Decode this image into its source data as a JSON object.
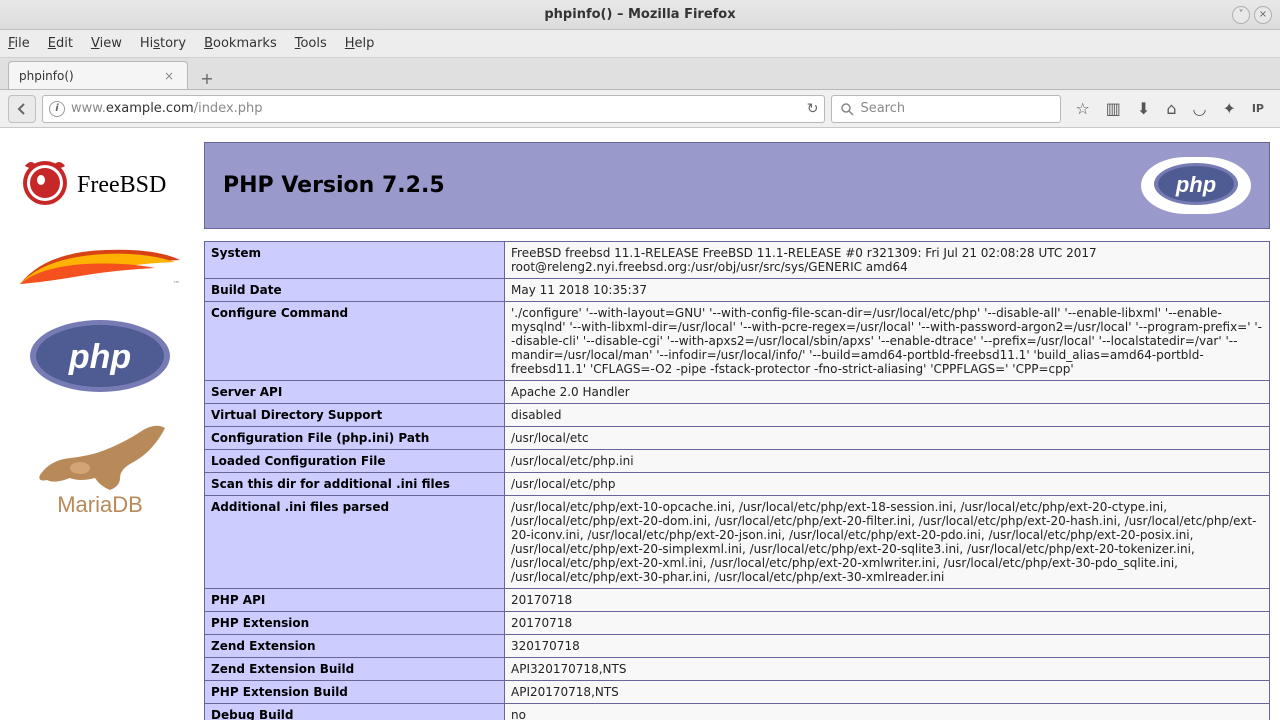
{
  "window": {
    "title": "phpinfo() – Mozilla Firefox"
  },
  "menu": {
    "file": "File",
    "edit": "Edit",
    "view": "View",
    "history": "History",
    "bookmarks": "Bookmarks",
    "tools": "Tools",
    "help": "Help"
  },
  "tab": {
    "title": "phpinfo()"
  },
  "url": {
    "prefix": "www.",
    "host": "example.com",
    "path": "/index.php"
  },
  "search": {
    "placeholder": "Search"
  },
  "sidebar": {
    "logos": [
      {
        "name": "FreeBSD"
      },
      {
        "name": "Apache"
      },
      {
        "name": "php"
      },
      {
        "name": "MariaDB"
      }
    ]
  },
  "php": {
    "header": "PHP Version 7.2.5",
    "rows": [
      {
        "k": "System",
        "v": "FreeBSD freebsd 11.1-RELEASE FreeBSD 11.1-RELEASE #0 r321309: Fri Jul 21 02:08:28 UTC 2017 root@releng2.nyi.freebsd.org:/usr/obj/usr/src/sys/GENERIC amd64"
      },
      {
        "k": "Build Date",
        "v": "May 11 2018 10:35:37"
      },
      {
        "k": "Configure Command",
        "v": "'./configure' '--with-layout=GNU' '--with-config-file-scan-dir=/usr/local/etc/php' '--disable-all' '--enable-libxml' '--enable-mysqlnd' '--with-libxml-dir=/usr/local' '--with-pcre-regex=/usr/local' '--with-password-argon2=/usr/local' '--program-prefix=' '--disable-cli' '--disable-cgi' '--with-apxs2=/usr/local/sbin/apxs' '--enable-dtrace' '--prefix=/usr/local' '--localstatedir=/var' '--mandir=/usr/local/man' '--infodir=/usr/local/info/' '--build=amd64-portbld-freebsd11.1' 'build_alias=amd64-portbld-freebsd11.1' 'CFLAGS=-O2 -pipe -fstack-protector -fno-strict-aliasing' 'CPPFLAGS=' 'CPP=cpp'"
      },
      {
        "k": "Server API",
        "v": "Apache 2.0 Handler"
      },
      {
        "k": "Virtual Directory Support",
        "v": "disabled"
      },
      {
        "k": "Configuration File (php.ini) Path",
        "v": "/usr/local/etc"
      },
      {
        "k": "Loaded Configuration File",
        "v": "/usr/local/etc/php.ini"
      },
      {
        "k": "Scan this dir for additional .ini files",
        "v": "/usr/local/etc/php"
      },
      {
        "k": "Additional .ini files parsed",
        "v": "/usr/local/etc/php/ext-10-opcache.ini, /usr/local/etc/php/ext-18-session.ini, /usr/local/etc/php/ext-20-ctype.ini, /usr/local/etc/php/ext-20-dom.ini, /usr/local/etc/php/ext-20-filter.ini, /usr/local/etc/php/ext-20-hash.ini, /usr/local/etc/php/ext-20-iconv.ini, /usr/local/etc/php/ext-20-json.ini, /usr/local/etc/php/ext-20-pdo.ini, /usr/local/etc/php/ext-20-posix.ini, /usr/local/etc/php/ext-20-simplexml.ini, /usr/local/etc/php/ext-20-sqlite3.ini, /usr/local/etc/php/ext-20-tokenizer.ini, /usr/local/etc/php/ext-20-xml.ini, /usr/local/etc/php/ext-20-xmlwriter.ini, /usr/local/etc/php/ext-30-pdo_sqlite.ini, /usr/local/etc/php/ext-30-phar.ini, /usr/local/etc/php/ext-30-xmlreader.ini"
      },
      {
        "k": "PHP API",
        "v": "20170718"
      },
      {
        "k": "PHP Extension",
        "v": "20170718"
      },
      {
        "k": "Zend Extension",
        "v": "320170718"
      },
      {
        "k": "Zend Extension Build",
        "v": "API320170718,NTS"
      },
      {
        "k": "PHP Extension Build",
        "v": "API20170718,NTS"
      },
      {
        "k": "Debug Build",
        "v": "no"
      }
    ]
  }
}
